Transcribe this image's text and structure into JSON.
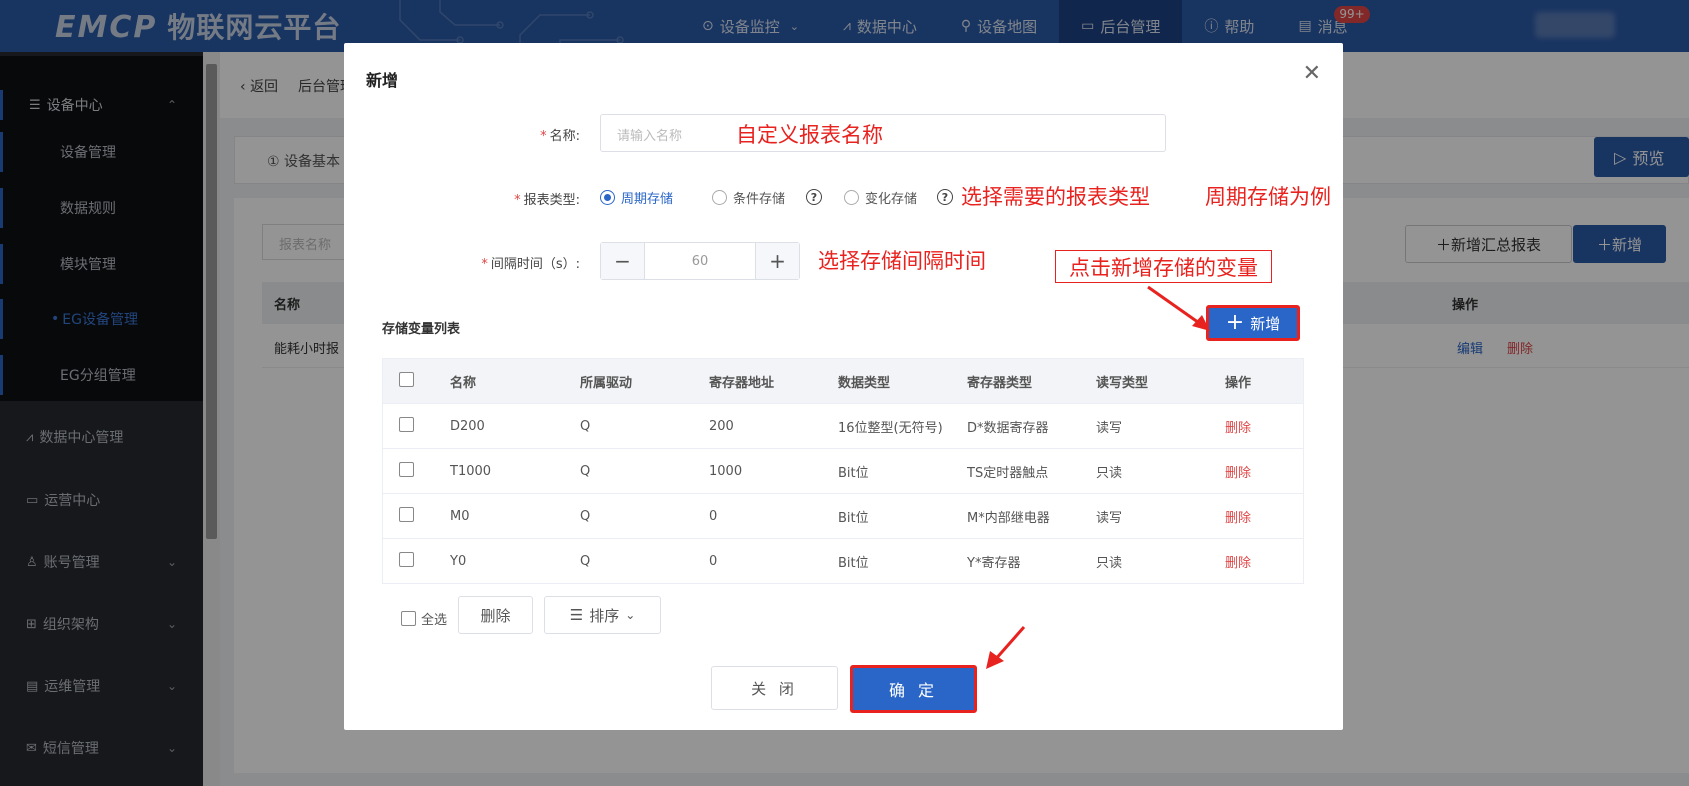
{
  "topbar": {
    "logo_en": "EMCP",
    "logo_cn": "物联网云平台",
    "nav": [
      {
        "label": "设备监控",
        "icon": "location-icon",
        "dropdown": true
      },
      {
        "label": "数据中心",
        "icon": "chart-icon"
      },
      {
        "label": "设备地图",
        "icon": "user-pin-icon"
      },
      {
        "label": "后台管理",
        "icon": "monitor-icon",
        "active": true
      },
      {
        "label": "帮助",
        "icon": "help-icon"
      },
      {
        "label": "消息",
        "icon": "message-icon",
        "badge": "99+"
      }
    ]
  },
  "sidebar": {
    "group_title": "设备中心",
    "group_items": [
      "设备管理",
      "数据规则",
      "模块管理",
      "EG设备管理",
      "EG分组管理"
    ],
    "active_item": "EG设备管理",
    "items": [
      {
        "label": "数据中心管理",
        "icon": "chart-icon",
        "chevron": false
      },
      {
        "label": "运营中心",
        "icon": "monitor-icon",
        "chevron": false
      },
      {
        "label": "账号管理",
        "icon": "user-icon",
        "chevron": true
      },
      {
        "label": "组织架构",
        "icon": "org-icon",
        "chevron": true
      },
      {
        "label": "运维管理",
        "icon": "doc-icon",
        "chevron": true
      },
      {
        "label": "短信管理",
        "icon": "sms-icon",
        "chevron": true
      }
    ]
  },
  "background": {
    "back_label": "返回",
    "breadcrumb": "后台管理",
    "tab_label": "设备基本",
    "preview_label": "预览",
    "search_placeholder": "报表名称",
    "add_summary_label": "新增汇总报表",
    "add_label": "新增",
    "col_name": "名称",
    "col_ops": "操作",
    "row_name": "能耗小时报",
    "row_edit": "编辑",
    "row_delete": "删除"
  },
  "modal": {
    "title": "新增",
    "name_label": "名称:",
    "name_placeholder": "请输入名称",
    "type_label": "报表类型:",
    "type_options": [
      "周期存储",
      "条件存储",
      "变化存储"
    ],
    "type_selected": "周期存储",
    "interval_label": "间隔时间（s）:",
    "interval_value": "60",
    "list_title": "存储变量列表",
    "add_button": "新增",
    "columns": [
      "名称",
      "所属驱动",
      "寄存器地址",
      "数据类型",
      "寄存器类型",
      "读写类型",
      "操作"
    ],
    "rows": [
      [
        "D200",
        "Q",
        "200",
        "16位整型(无符号)",
        "D*数据寄存器",
        "读写",
        "删除"
      ],
      [
        "T1000",
        "Q",
        "1000",
        "Bit位",
        "TS定时器触点",
        "只读",
        "删除"
      ],
      [
        "M0",
        "Q",
        "0",
        "Bit位",
        "M*内部继电器",
        "读写",
        "删除"
      ],
      [
        "Y0",
        "Q",
        "0",
        "Bit位",
        "Y*寄存器",
        "只读",
        "删除"
      ]
    ],
    "select_all": "全选",
    "delete_button": "删除",
    "sort_button": "排序",
    "close_button": "关 闭",
    "confirm_button": "确 定"
  },
  "annotations": {
    "name_hint": "自定义报表名称",
    "type_hint": "选择需要的报表类型",
    "type_example": "周期存储为例",
    "interval_hint": "选择存储间隔时间",
    "add_hint": "点击新增存储的变量"
  },
  "colors": {
    "brand": "#2a5aa8",
    "primary": "#2a66c8",
    "annotation_red": "#e8231f",
    "sidebar_bg": "#262a30"
  }
}
